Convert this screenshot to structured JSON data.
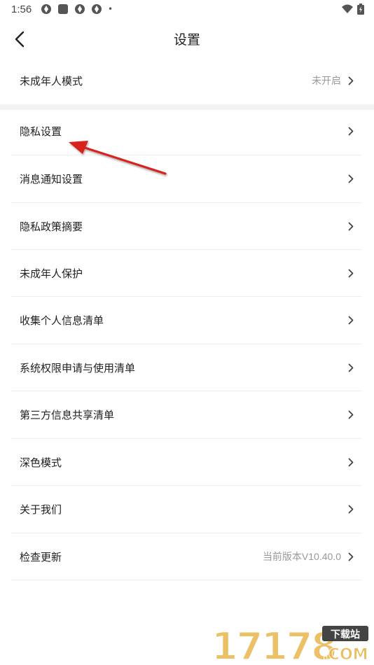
{
  "status_bar": {
    "time": "1:56",
    "dot": "•"
  },
  "header": {
    "title": "设置"
  },
  "rows": [
    {
      "label": "未成年人模式",
      "value": "未开启"
    },
    {
      "label": "隐私设置",
      "value": ""
    },
    {
      "label": "消息通知设置",
      "value": ""
    },
    {
      "label": "隐私政策摘要",
      "value": ""
    },
    {
      "label": "未成年人保护",
      "value": ""
    },
    {
      "label": "收集个人信息清单",
      "value": ""
    },
    {
      "label": "系统权限申请与使用清单",
      "value": ""
    },
    {
      "label": "第三方信息共享清单",
      "value": ""
    },
    {
      "label": "深色模式",
      "value": ""
    },
    {
      "label": "关于我们",
      "value": ""
    },
    {
      "label": "检查更新",
      "value": "当前版本V10.40.0"
    }
  ],
  "watermark": {
    "digits": "17178",
    "badge": "下载站",
    "domain": ".COM"
  },
  "colors": {
    "annotation_arrow": "#d9231d",
    "watermark_gold": "#e8b64c"
  }
}
